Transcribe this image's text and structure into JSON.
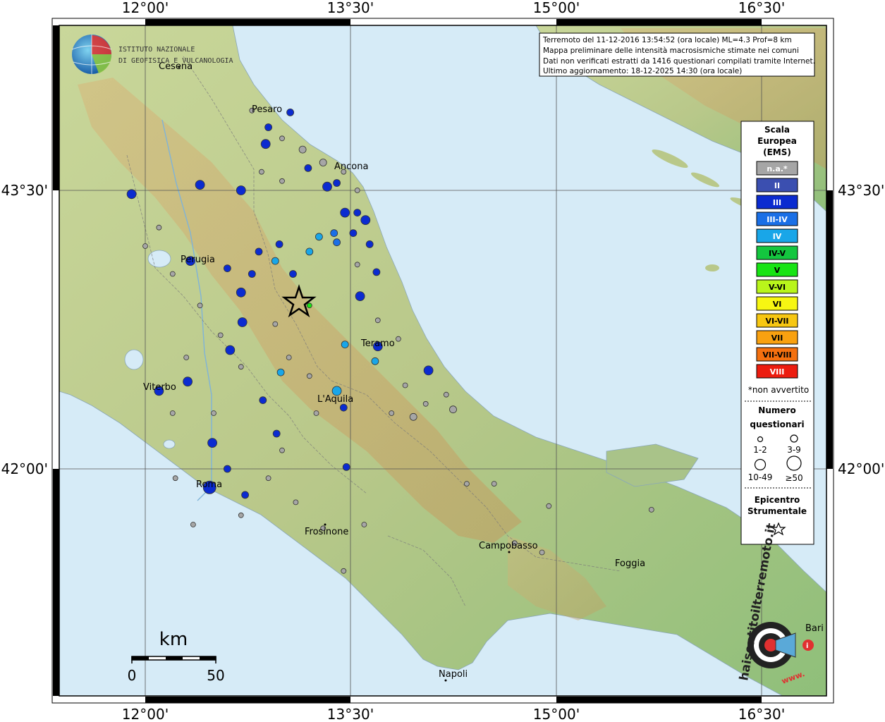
{
  "header": {
    "line1": "Terremoto del 11-12-2016 13:54:52 (ora locale) ML=4.3 Prof=8 km",
    "line2": "Mappa preliminare delle intensità macrosismiche stimate nei comuni",
    "line3": "Dati non verificati estratti da 1416 questionari compilati tramite Internet.",
    "line4": "Ultimo aggiornamento: 18-12-2025 14:30 (ora locale)"
  },
  "logo": {
    "line1": "ISTITUTO NAZIONALE",
    "line2": "DI GEOFISICA E VULCANOLOGIA"
  },
  "axes": {
    "lon_ticks": [
      "12°00'",
      "13°30'",
      "15°00'",
      "16°30'"
    ],
    "lat_ticks": [
      "43°30'",
      "42°00'"
    ]
  },
  "cities": [
    {
      "name": "Cesena"
    },
    {
      "name": "Pesaro"
    },
    {
      "name": "Ancona"
    },
    {
      "name": "Perugia"
    },
    {
      "name": "Teramo"
    },
    {
      "name": "Viterbo"
    },
    {
      "name": "L'Aquila"
    },
    {
      "name": "Roma"
    },
    {
      "name": "Frosinone"
    },
    {
      "name": "Campobasso"
    },
    {
      "name": "Foggia"
    },
    {
      "name": "Napoli"
    },
    {
      "name": "Bari"
    }
  ],
  "legend": {
    "title1": "Scala",
    "title2": "Europea",
    "title3": "(EMS)",
    "levels": [
      {
        "label": "n.a.*",
        "color": "#a6a6a6",
        "text": "#ffffff"
      },
      {
        "label": "II",
        "color": "#3b4fb0",
        "text": "#ffffff"
      },
      {
        "label": "III",
        "color": "#0b2bd0",
        "text": "#ffffff"
      },
      {
        "label": "III-IV",
        "color": "#1a6fe6",
        "text": "#ffffff"
      },
      {
        "label": "IV",
        "color": "#19a6e8",
        "text": "#ffffff"
      },
      {
        "label": "IV-V",
        "color": "#14c63f",
        "text": "#000000"
      },
      {
        "label": "V",
        "color": "#18e414",
        "text": "#000000"
      },
      {
        "label": "V-VI",
        "color": "#b9f51b",
        "text": "#000000"
      },
      {
        "label": "VI",
        "color": "#f7f612",
        "text": "#000000"
      },
      {
        "label": "VI-VII",
        "color": "#f7c712",
        "text": "#000000"
      },
      {
        "label": "VII",
        "color": "#f9a110",
        "text": "#000000"
      },
      {
        "label": "VII-VIII",
        "color": "#f4700f",
        "text": "#000000"
      },
      {
        "label": "VIII",
        "color": "#ec1c0f",
        "text": "#ffffff"
      }
    ],
    "not_felt_note": "*non avvertito",
    "count_title1": "Numero",
    "count_title2": "questionari",
    "count_labels": [
      "1-2",
      "3-9",
      "10-49",
      "≥50"
    ],
    "epicenter_title1": "Epicentro",
    "epicenter_title2": "Strumentale"
  },
  "scale_bar": {
    "unit": "km",
    "min": "0",
    "max": "50"
  },
  "watermark": {
    "brand": "haisentitoilterremoto.it",
    "url": "www."
  },
  "epicenter": {
    "lon": 13.23,
    "lat": 42.88
  },
  "intensity_points_note": "sample of questionnaire intensity circles, lon/lat in degrees",
  "points": [
    {
      "lon": 12.4,
      "lat": 43.53,
      "c": "#0b2bd0",
      "s": 3
    },
    {
      "lon": 12.7,
      "lat": 43.5,
      "c": "#0b2bd0",
      "s": 3
    },
    {
      "lon": 12.9,
      "lat": 43.84,
      "c": "#0b2bd0",
      "s": 2
    },
    {
      "lon": 12.88,
      "lat": 43.75,
      "c": "#0b2bd0",
      "s": 3
    },
    {
      "lon": 13.06,
      "lat": 43.92,
      "c": "#0b2bd0",
      "s": 2
    },
    {
      "lon": 13.19,
      "lat": 43.62,
      "c": "#0b2bd0",
      "s": 2
    },
    {
      "lon": 13.33,
      "lat": 43.52,
      "c": "#0b2bd0",
      "s": 3
    },
    {
      "lon": 13.4,
      "lat": 43.54,
      "c": "#0b2bd0",
      "s": 2
    },
    {
      "lon": 13.46,
      "lat": 43.38,
      "c": "#0b2bd0",
      "s": 3
    },
    {
      "lon": 13.55,
      "lat": 43.38,
      "c": "#0b2bd0",
      "s": 2
    },
    {
      "lon": 13.61,
      "lat": 43.34,
      "c": "#0b2bd0",
      "s": 3
    },
    {
      "lon": 13.52,
      "lat": 43.27,
      "c": "#0b2bd0",
      "s": 2
    },
    {
      "lon": 13.64,
      "lat": 43.21,
      "c": "#0b2bd0",
      "s": 2
    },
    {
      "lon": 13.69,
      "lat": 43.06,
      "c": "#0b2bd0",
      "s": 2
    },
    {
      "lon": 13.57,
      "lat": 42.93,
      "c": "#0b2bd0",
      "s": 3
    },
    {
      "lon": 13.7,
      "lat": 42.66,
      "c": "#0b2bd0",
      "s": 3
    },
    {
      "lon": 14.07,
      "lat": 42.53,
      "c": "#0b2bd0",
      "s": 3
    },
    {
      "lon": 12.33,
      "lat": 43.12,
      "c": "#0b2bd0",
      "s": 3
    },
    {
      "lon": 12.7,
      "lat": 42.95,
      "c": "#0b2bd0",
      "s": 3
    },
    {
      "lon": 12.71,
      "lat": 42.79,
      "c": "#0b2bd0",
      "s": 3
    },
    {
      "lon": 12.62,
      "lat": 42.64,
      "c": "#0b2bd0",
      "s": 3
    },
    {
      "lon": 12.31,
      "lat": 42.47,
      "c": "#0b2bd0",
      "s": 3
    },
    {
      "lon": 12.49,
      "lat": 42.14,
      "c": "#0b2bd0",
      "s": 3
    },
    {
      "lon": 12.47,
      "lat": 41.9,
      "c": "#0b2bd0",
      "s": 4
    },
    {
      "lon": 12.6,
      "lat": 42.0,
      "c": "#0b2bd0",
      "s": 2
    },
    {
      "lon": 12.73,
      "lat": 41.86,
      "c": "#0b2bd0",
      "s": 2
    },
    {
      "lon": 12.86,
      "lat": 42.37,
      "c": "#0b2bd0",
      "s": 2
    },
    {
      "lon": 12.96,
      "lat": 42.19,
      "c": "#0b2bd0",
      "s": 2
    },
    {
      "lon": 13.45,
      "lat": 42.33,
      "c": "#0b2bd0",
      "s": 2
    },
    {
      "lon": 13.47,
      "lat": 42.01,
      "c": "#0b2bd0",
      "s": 2
    },
    {
      "lon": 12.1,
      "lat": 42.42,
      "c": "#0b2bd0",
      "s": 3
    },
    {
      "lon": 11.9,
      "lat": 43.48,
      "c": "#0b2bd0",
      "s": 3
    },
    {
      "lon": 12.6,
      "lat": 43.08,
      "c": "#0b2bd0",
      "s": 2
    },
    {
      "lon": 12.83,
      "lat": 43.17,
      "c": "#0b2bd0",
      "s": 2
    },
    {
      "lon": 12.78,
      "lat": 43.05,
      "c": "#0b2bd0",
      "s": 2
    },
    {
      "lon": 12.98,
      "lat": 43.21,
      "c": "#0b2bd0",
      "s": 2
    },
    {
      "lon": 13.08,
      "lat": 43.05,
      "c": "#0b2bd0",
      "s": 2
    },
    {
      "lon": 13.38,
      "lat": 43.27,
      "c": "#1a6fe6",
      "s": 2
    },
    {
      "lon": 13.4,
      "lat": 43.22,
      "c": "#1a6fe6",
      "s": 2
    },
    {
      "lon": 13.27,
      "lat": 43.25,
      "c": "#19a6e8",
      "s": 2
    },
    {
      "lon": 12.95,
      "lat": 43.12,
      "c": "#19a6e8",
      "s": 2
    },
    {
      "lon": 13.2,
      "lat": 43.17,
      "c": "#19a6e8",
      "s": 2
    },
    {
      "lon": 12.99,
      "lat": 42.52,
      "c": "#19a6e8",
      "s": 2
    },
    {
      "lon": 13.46,
      "lat": 42.67,
      "c": "#19a6e8",
      "s": 2
    },
    {
      "lon": 13.68,
      "lat": 42.58,
      "c": "#19a6e8",
      "s": 2
    },
    {
      "lon": 13.4,
      "lat": 42.42,
      "c": "#19a6e8",
      "s": 3
    },
    {
      "lon": 13.2,
      "lat": 42.88,
      "c": "#18e414",
      "s": 1
    },
    {
      "lon": 12.78,
      "lat": 43.93,
      "c": "#a6a6a6",
      "s": 1
    },
    {
      "lon": 13.0,
      "lat": 43.78,
      "c": "#a6a6a6",
      "s": 1
    },
    {
      "lon": 13.15,
      "lat": 43.72,
      "c": "#a6a6a6",
      "s": 2
    },
    {
      "lon": 13.3,
      "lat": 43.65,
      "c": "#a6a6a6",
      "s": 2
    },
    {
      "lon": 13.0,
      "lat": 43.55,
      "c": "#a6a6a6",
      "s": 1
    },
    {
      "lon": 12.85,
      "lat": 43.6,
      "c": "#a6a6a6",
      "s": 1
    },
    {
      "lon": 12.1,
      "lat": 43.3,
      "c": "#a6a6a6",
      "s": 1
    },
    {
      "lon": 12.0,
      "lat": 43.2,
      "c": "#a6a6a6",
      "s": 1
    },
    {
      "lon": 12.2,
      "lat": 43.05,
      "c": "#a6a6a6",
      "s": 1
    },
    {
      "lon": 12.4,
      "lat": 42.88,
      "c": "#a6a6a6",
      "s": 1
    },
    {
      "lon": 12.55,
      "lat": 42.72,
      "c": "#a6a6a6",
      "s": 1
    },
    {
      "lon": 12.3,
      "lat": 42.6,
      "c": "#a6a6a6",
      "s": 1
    },
    {
      "lon": 12.2,
      "lat": 42.3,
      "c": "#a6a6a6",
      "s": 1
    },
    {
      "lon": 12.5,
      "lat": 42.3,
      "c": "#a6a6a6",
      "s": 1
    },
    {
      "lon": 12.7,
      "lat": 42.55,
      "c": "#a6a6a6",
      "s": 1
    },
    {
      "lon": 12.95,
      "lat": 42.78,
      "c": "#a6a6a6",
      "s": 1
    },
    {
      "lon": 13.05,
      "lat": 42.6,
      "c": "#a6a6a6",
      "s": 1
    },
    {
      "lon": 13.2,
      "lat": 42.5,
      "c": "#a6a6a6",
      "s": 1
    },
    {
      "lon": 13.25,
      "lat": 42.3,
      "c": "#a6a6a6",
      "s": 1
    },
    {
      "lon": 13.0,
      "lat": 42.1,
      "c": "#a6a6a6",
      "s": 1
    },
    {
      "lon": 12.9,
      "lat": 41.95,
      "c": "#a6a6a6",
      "s": 1
    },
    {
      "lon": 13.1,
      "lat": 41.82,
      "c": "#a6a6a6",
      "s": 1
    },
    {
      "lon": 13.3,
      "lat": 41.68,
      "c": "#a6a6a6",
      "s": 1
    },
    {
      "lon": 13.6,
      "lat": 41.7,
      "c": "#a6a6a6",
      "s": 1
    },
    {
      "lon": 13.8,
      "lat": 42.3,
      "c": "#a6a6a6",
      "s": 1
    },
    {
      "lon": 13.9,
      "lat": 42.45,
      "c": "#a6a6a6",
      "s": 1
    },
    {
      "lon": 14.05,
      "lat": 42.35,
      "c": "#a6a6a6",
      "s": 1
    },
    {
      "lon": 14.2,
      "lat": 42.4,
      "c": "#a6a6a6",
      "s": 1
    },
    {
      "lon": 13.7,
      "lat": 42.8,
      "c": "#a6a6a6",
      "s": 1
    },
    {
      "lon": 13.85,
      "lat": 42.7,
      "c": "#a6a6a6",
      "s": 1
    },
    {
      "lon": 13.55,
      "lat": 43.1,
      "c": "#a6a6a6",
      "s": 1
    },
    {
      "lon": 13.55,
      "lat": 43.5,
      "c": "#a6a6a6",
      "s": 1
    },
    {
      "lon": 13.45,
      "lat": 43.6,
      "c": "#a6a6a6",
      "s": 1
    },
    {
      "lon": 14.25,
      "lat": 42.32,
      "c": "#a6a6a6",
      "s": 2
    },
    {
      "lon": 13.96,
      "lat": 42.28,
      "c": "#a6a6a6",
      "s": 2
    },
    {
      "lon": 12.22,
      "lat": 41.95,
      "c": "#a6a6a6",
      "s": 1
    },
    {
      "lon": 12.7,
      "lat": 41.75,
      "c": "#a6a6a6",
      "s": 1
    },
    {
      "lon": 12.35,
      "lat": 41.7,
      "c": "#a6a6a6",
      "s": 1
    },
    {
      "lon": 13.45,
      "lat": 41.45,
      "c": "#a6a6a6",
      "s": 1
    },
    {
      "lon": 14.7,
      "lat": 41.6,
      "c": "#a6a6a6",
      "s": 1
    },
    {
      "lon": 14.95,
      "lat": 41.8,
      "c": "#a6a6a6",
      "s": 1
    },
    {
      "lon": 15.7,
      "lat": 41.78,
      "c": "#a6a6a6",
      "s": 1
    },
    {
      "lon": 14.9,
      "lat": 41.55,
      "c": "#a6a6a6",
      "s": 1
    },
    {
      "lon": 14.35,
      "lat": 41.92,
      "c": "#a6a6a6",
      "s": 1
    },
    {
      "lon": 14.55,
      "lat": 41.92,
      "c": "#a6a6a6",
      "s": 1
    }
  ]
}
